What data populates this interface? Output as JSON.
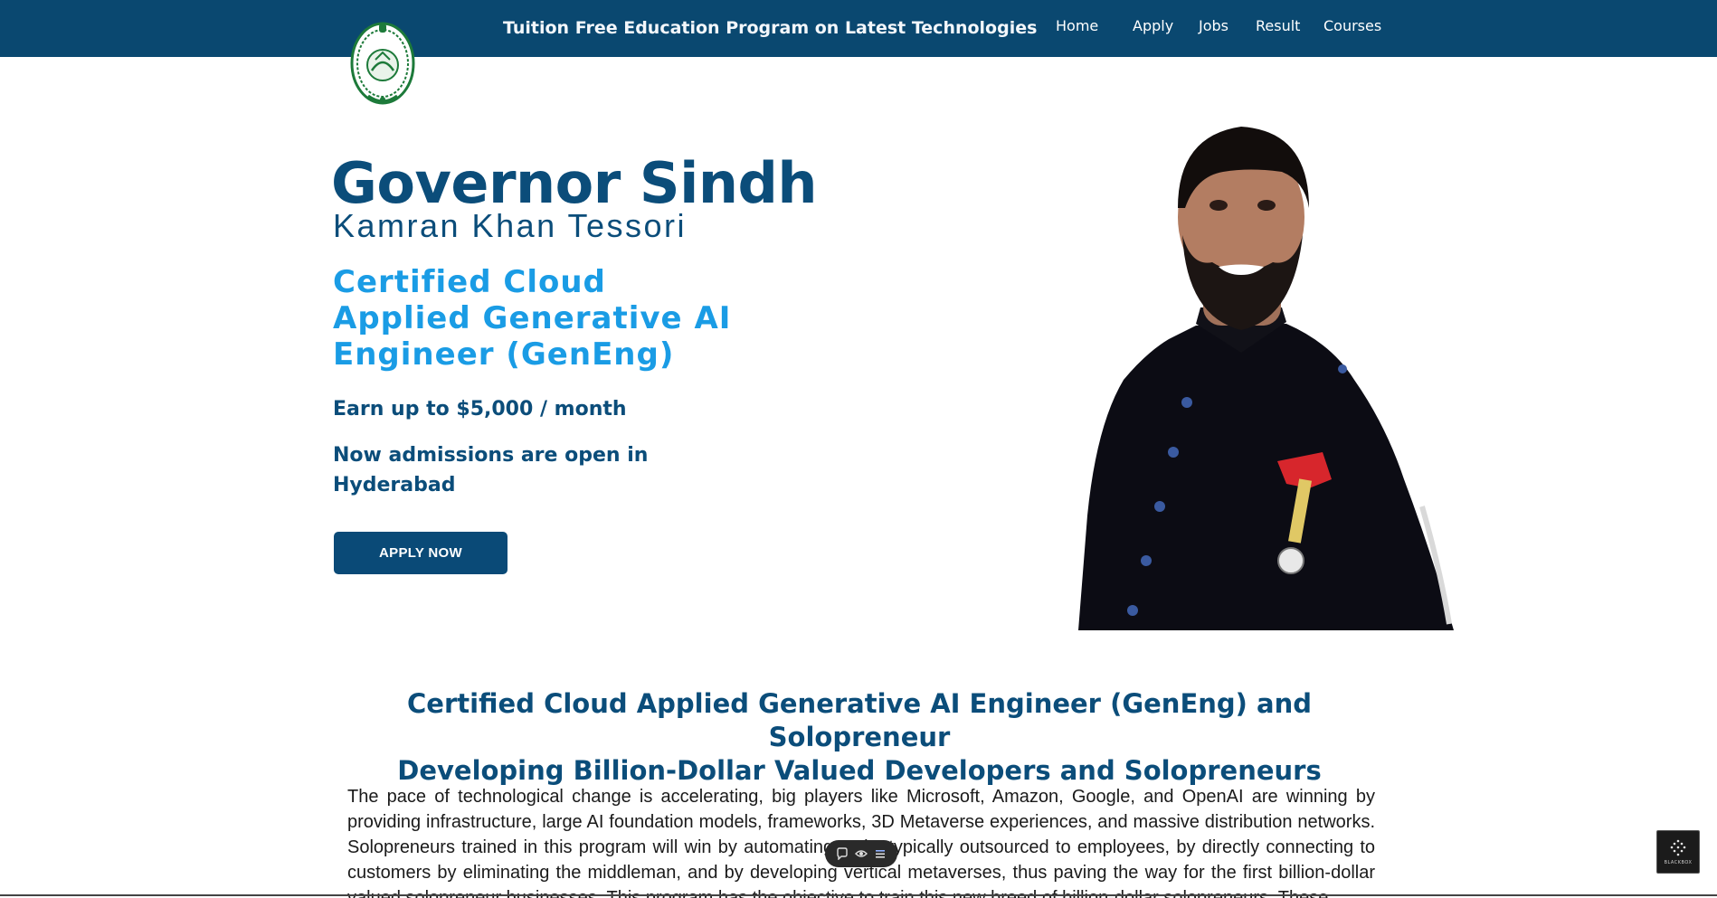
{
  "header": {
    "site_title": "Tuition Free Education Program on Latest Technologies",
    "nav": [
      {
        "label": "Home"
      },
      {
        "label": "Apply"
      },
      {
        "label": "Jobs"
      },
      {
        "label": "Result"
      },
      {
        "label": "Courses"
      }
    ],
    "logo_icon": "governor-house-emblem-icon"
  },
  "hero": {
    "name": "Governor Sindh",
    "subtitle": "Kamran Khan Tessori",
    "certificate_lines": [
      "Certified Cloud",
      "Applied Generative AI",
      "Engineer (GenEng)"
    ],
    "earn": "Earn up to $5,000 / month",
    "admissions": "Now admissions are open in Hyderabad",
    "apply_button": "APPLY NOW",
    "portrait_icon": "governor-portrait"
  },
  "section": {
    "title_line1": "Certified Cloud Applied Generative AI Engineer (GenEng) and Solopreneur",
    "title_line2": "Developing Billion-Dollar Valued Developers and Solopreneurs",
    "paragraph": "The pace of technological change is accelerating, big players like Microsoft, Amazon, Google, and OpenAI are winning by providing infrastructure, large AI foundation models, frameworks, 3D Metaverse experiences, and massive distribution networks. Solopreneurs trained in this program will win by automating tasks typically outsourced to employees, by directly connecting to customers by eliminating the middleman, and by developing vertical metaverses, thus paving the way for the first billion-dollar valued solopreneur businesses. This program has the objective to train this new breed of billion-dollar solopreneurs. These"
  },
  "overlay": {
    "badge_label": "BLACKBOX",
    "toolbar_icons": [
      "chat-bubble-icon",
      "eye-icon",
      "list-icon"
    ]
  },
  "colors": {
    "header_bg": "#0a4870",
    "heading_blue": "#0b4d7a",
    "accent_blue": "#1a9ce5",
    "button_bg": "#0a4a77"
  }
}
